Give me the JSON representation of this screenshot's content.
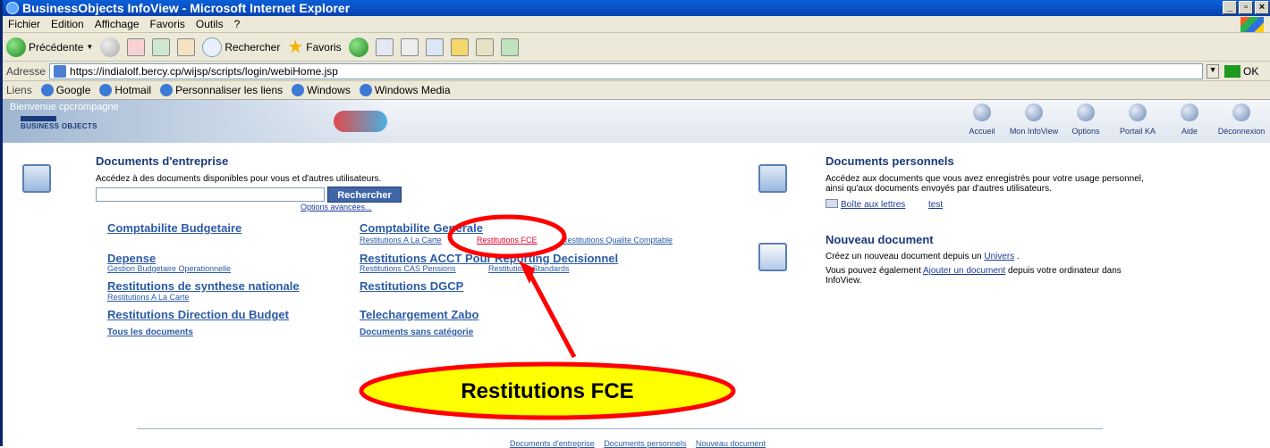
{
  "window": {
    "title": "BusinessObjects InfoView - Microsoft Internet Explorer"
  },
  "menu": [
    "Fichier",
    "Edition",
    "Affichage",
    "Favoris",
    "Outils",
    "?"
  ],
  "toolbar": {
    "back": "Précédente",
    "search": "Rechercher",
    "favorites": "Favoris"
  },
  "address": {
    "label": "Adresse",
    "url": "https://indialolf.bercy.cp/wijsp/scripts/login/webiHome.jsp",
    "go": "OK"
  },
  "links": {
    "label": "Liens",
    "items": [
      "Google",
      "Hotmail",
      "Personnaliser les liens",
      "Windows",
      "Windows Media"
    ]
  },
  "header": {
    "welcome": "Bienvenue cpcrompagne",
    "logo": "BUSINESS OBJECTS",
    "nav": [
      "Accueil",
      "Mon InfoView",
      "Options",
      "Portail KA",
      "Aide",
      "Déconnexion"
    ]
  },
  "company_docs": {
    "title": "Documents d'entreprise",
    "desc": "Accédez à des documents disponibles pour vous et d'autres utilisateurs.",
    "search_button": "Rechercher",
    "advanced": "Options avancées...",
    "col1": [
      {
        "title": "Comptabilite Budgetaire",
        "subs": []
      },
      {
        "title": "Depense",
        "subs": [
          "Gestion Budgetaire Operationnelle"
        ]
      },
      {
        "title": "Restitutions de synthese nationale",
        "subs": [
          "Restitutions A La Carte"
        ]
      },
      {
        "title": "Restitutions Direction du Budget",
        "subs": []
      }
    ],
    "col2": [
      {
        "title": "Comptabilite Generale",
        "subs": [
          "Restitutions A La Carte",
          "Restitutions FCE",
          "Restitutions Qualite Comptable"
        ]
      },
      {
        "title": "Restitutions ACCT Pour Reporting Decisionnel",
        "subs": [
          "Restitutions CAS Pensions",
          "Restitutions Standards"
        ]
      },
      {
        "title": "Restitutions DGCP",
        "subs": []
      },
      {
        "title": "Telechargement Zabo",
        "subs": []
      }
    ],
    "all_docs": "Tous les documents",
    "uncategorized": "Documents sans catégorie"
  },
  "personal_docs": {
    "title": "Documents personnels",
    "desc1": "Accédez aux documents que vous avez enregistrés pour votre usage personnel,",
    "desc2": "ainsi qu'aux documents envoyés par d'autres utilisateurs.",
    "inbox": "Boîte aux lettres",
    "test": "test"
  },
  "new_doc": {
    "title": "Nouveau document",
    "line1_pre": "Créez un nouveau document depuis un ",
    "line1_link": "Univers",
    "line1_post": " .",
    "line2_pre": "Vous pouvez également ",
    "line2_link": "Ajouter un document",
    "line2_post": " depuis votre ordinateur dans",
    "line3": "InfoView."
  },
  "footer": [
    "Documents d'entreprise",
    "Documents personnels",
    "Nouveau document"
  ],
  "callout": {
    "text": "Restitutions FCE",
    "fill": "#ffff00",
    "stroke": "#ff0000"
  }
}
